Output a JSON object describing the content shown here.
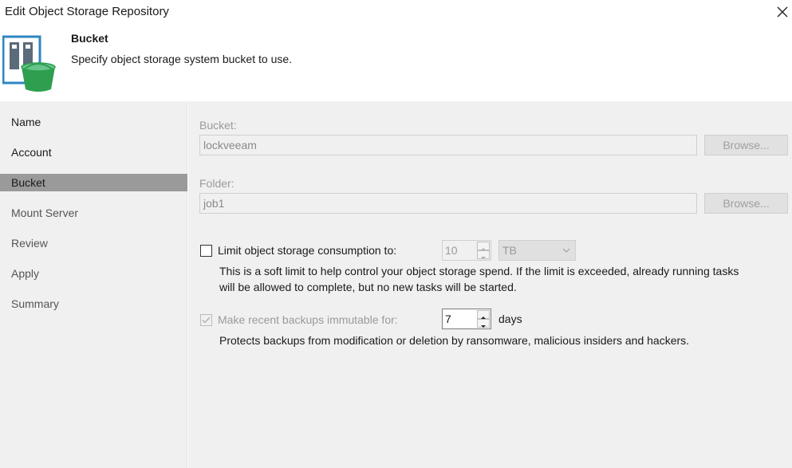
{
  "window": {
    "title": "Edit Object Storage Repository"
  },
  "header": {
    "title": "Bucket",
    "subtitle": "Specify object storage system bucket to use."
  },
  "nav": {
    "items": [
      {
        "label": "Name",
        "state": "done"
      },
      {
        "label": "Account",
        "state": "done"
      },
      {
        "label": "Bucket",
        "state": "active"
      },
      {
        "label": "Mount Server",
        "state": "todo"
      },
      {
        "label": "Review",
        "state": "todo"
      },
      {
        "label": "Apply",
        "state": "todo"
      },
      {
        "label": "Summary",
        "state": "todo"
      }
    ]
  },
  "bucket": {
    "label": "Bucket:",
    "value": "lockveeam",
    "browse_label": "Browse..."
  },
  "folder": {
    "label": "Folder:",
    "value": "job1",
    "browse_label": "Browse..."
  },
  "limit": {
    "checkbox_label": "Limit object storage consumption to:",
    "checked": false,
    "amount": "10",
    "unit": "TB",
    "help_line1": "This is a soft limit to help control your object storage spend. If the limit is exceeded, already running tasks",
    "help_line2": "will be allowed to complete, but no new tasks will be started."
  },
  "immutable": {
    "checkbox_label": "Make recent backups immutable for:",
    "checked": true,
    "days_value": "7",
    "days_label": "days",
    "help": "Protects backups from modification or deletion by ransomware, malicious insiders and hackers."
  },
  "colors": {
    "accent_blue": "#2e86c1",
    "bucket_green": "#2e9e4f",
    "nav_active": "#9a9a9a",
    "panel_bg": "#f0f0f0"
  }
}
